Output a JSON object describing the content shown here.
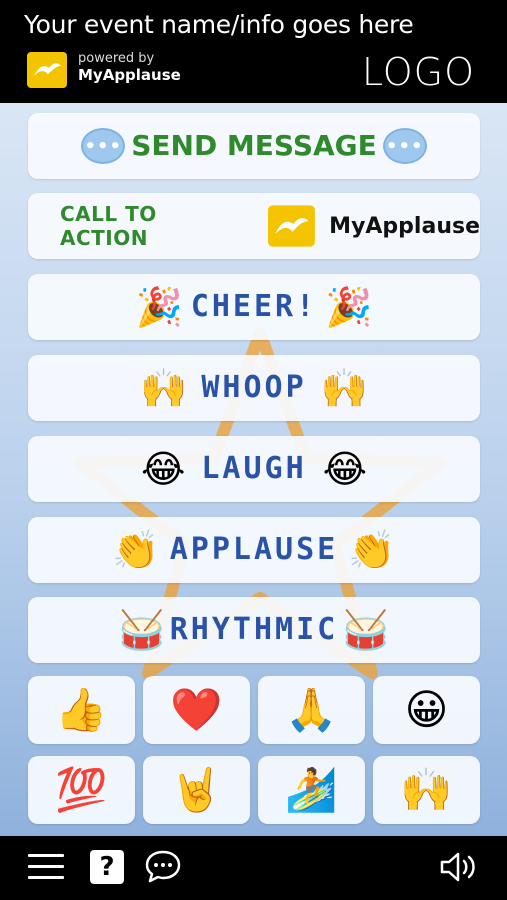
{
  "header": {
    "event_title": "Your event name/info goes here",
    "powered_by": "powered by",
    "brand_name": "MyApplause",
    "logo_text": "LOGO"
  },
  "buttons": {
    "send_message": {
      "label": "SEND MESSAGE",
      "icon": "speech-bubble-icon"
    },
    "call_to_action": {
      "label": "CALL TO ACTION",
      "brand": "MyApplause"
    },
    "cheer": {
      "label": "CHEER!",
      "emoji": "🎉"
    },
    "whoop": {
      "label": "WHOOP",
      "emoji": "🙌"
    },
    "laugh": {
      "label": "LAUGH",
      "emoji": "😂"
    },
    "applause": {
      "label": "APPLAUSE",
      "emoji": "👏"
    },
    "rhythmic": {
      "label": "RHYTHMIC",
      "emoji": "🥁"
    }
  },
  "reaction_tiles": [
    {
      "name": "thumbs-up",
      "emoji": "👍"
    },
    {
      "name": "heart",
      "emoji": "❤️"
    },
    {
      "name": "praying-hands",
      "emoji": "🙏"
    },
    {
      "name": "grinning-face",
      "emoji": "😀"
    },
    {
      "name": "hundred-points",
      "emoji": "💯"
    },
    {
      "name": "sign-of-horns",
      "emoji": "🤘"
    },
    {
      "name": "surfer",
      "emoji": "🏄"
    },
    {
      "name": "raising-hands",
      "emoji": "🙌"
    }
  ],
  "footer": {
    "help_glyph": "?",
    "icons": [
      "menu-icon",
      "help-icon",
      "chat-icon",
      "speaker-icon"
    ]
  },
  "colors": {
    "button_text_blue": "#2a53a8",
    "action_green": "#2e8a2b",
    "brand_yellow": "#f5c400",
    "star_orange": "#f0a030"
  }
}
